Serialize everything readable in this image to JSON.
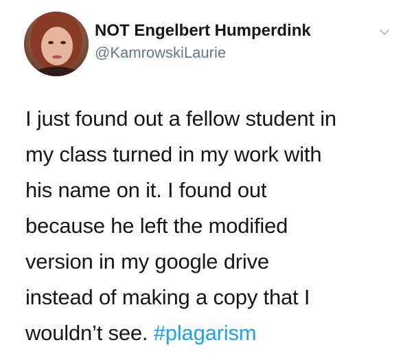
{
  "tweet": {
    "author": {
      "display_name": "NOT Engelbert Humperdink",
      "handle": "@KamrowskiLaurie",
      "avatar_icon": "profile-photo"
    },
    "menu_icon": "chevron-down-icon",
    "body_lines": [
      "I just found out a fellow student in",
      "my class turned in my work with",
      "his name on it. I found out",
      "because he left the modified",
      "version in my google drive",
      "instead of making a copy that I",
      "wouldn’t see. "
    ],
    "hashtag": "#plagarism",
    "colors": {
      "text": "#14171a",
      "secondary": "#657786",
      "link": "#1da1f2"
    }
  }
}
